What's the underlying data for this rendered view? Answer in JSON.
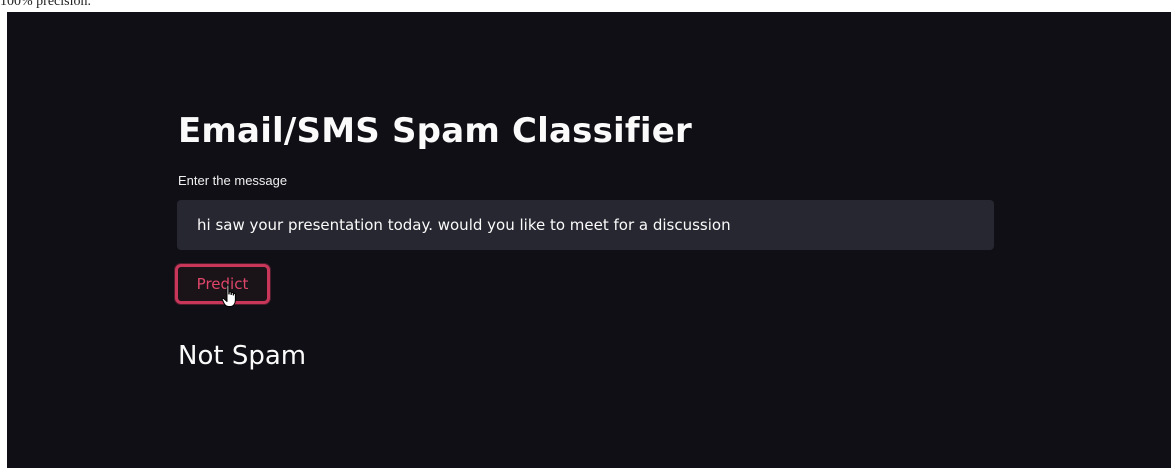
{
  "caption": "100% precision.",
  "app": {
    "title": "Email/SMS Spam Classifier",
    "input_label": "Enter the message",
    "message_value": "hi saw your presentation today. would you like to meet for a discussion",
    "predict_label": "Predict",
    "result": "Not Spam"
  },
  "colors": {
    "background": "#0f0f15",
    "input_background": "#262730",
    "accent": "#c8365a"
  },
  "icons": {
    "cursor": "hand-pointer-icon"
  }
}
